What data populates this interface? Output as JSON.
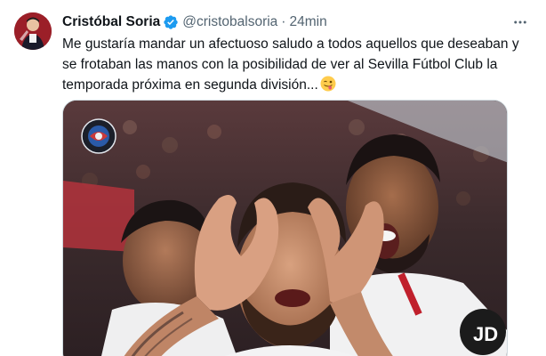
{
  "author": {
    "display_name": "Cristóbal Soria",
    "handle": "@cristobalsoria",
    "separator": "·",
    "time": "24min",
    "verified_icon": "verified-badge-icon",
    "avatar_icon": "profile-avatar"
  },
  "tweet": {
    "text_lines": [
      "Me gustaría mandar un afectuoso saludo a todos aquellos que deseaban y",
      "se frotaban las manos con la posibilidad de ver al Sevilla Fútbol Club la",
      "temporada próxima en segunda división..."
    ],
    "emoji": "winking-face-with-tongue-emoji"
  },
  "media": {
    "description_icon": "photo-football-celebration",
    "watermark_icon": "channel-logo-icon"
  },
  "colors": {
    "text": "#0f1419",
    "muted": "#536471",
    "verified": "#1d9bf0",
    "border": "#cfd9de"
  }
}
